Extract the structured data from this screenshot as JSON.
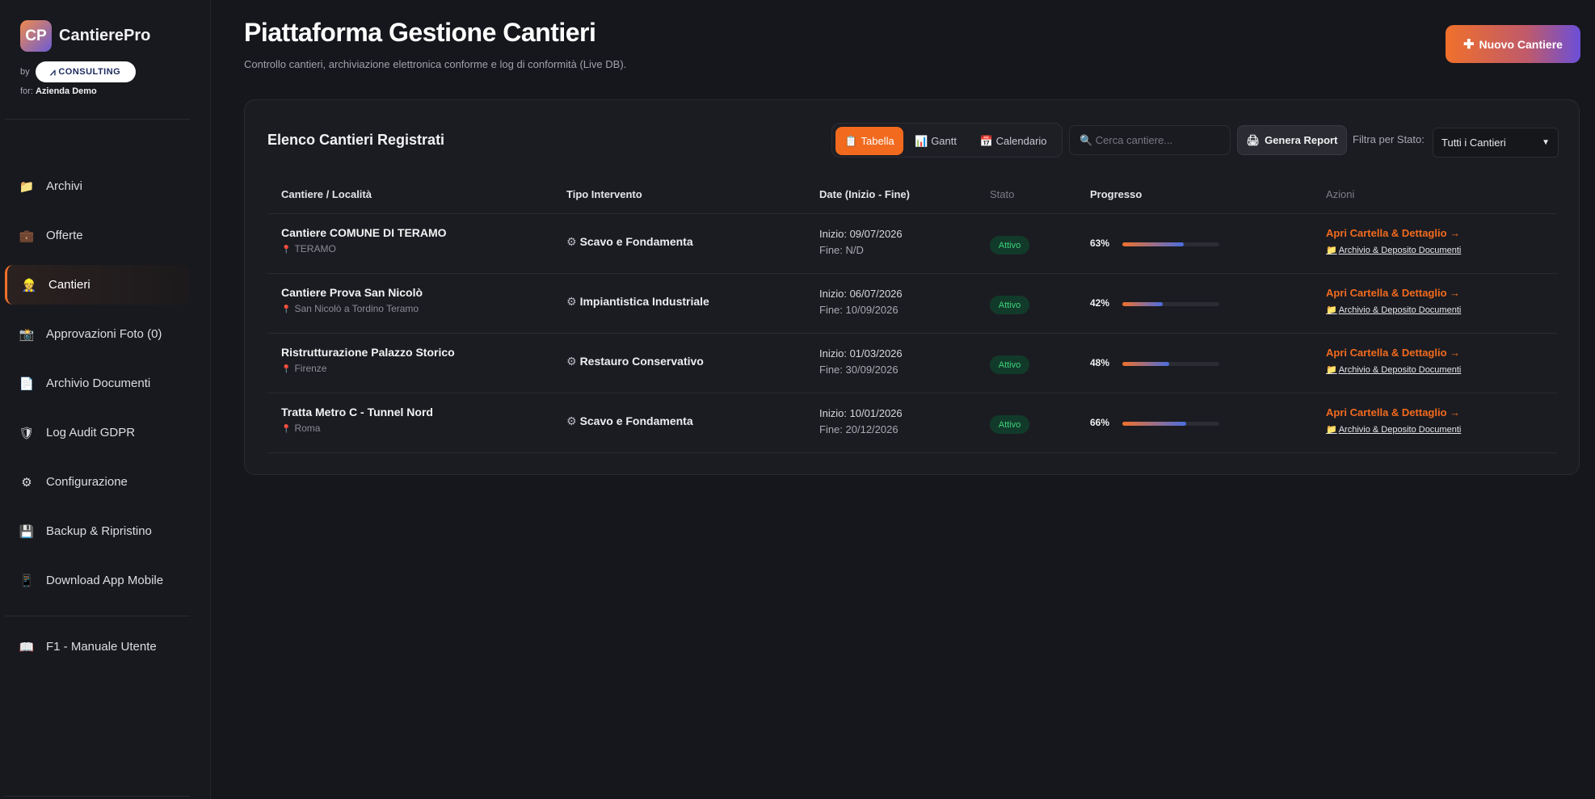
{
  "brand": {
    "logo_text": "CP",
    "name": "CantierePro",
    "by": "by",
    "partner": "CONSULTING",
    "for_label": "for:",
    "company": "Azienda Demo"
  },
  "sidebar": {
    "items": [
      {
        "label": "Archivi",
        "icon": "folder-icon"
      },
      {
        "label": "Offerte",
        "icon": "briefcase-icon"
      },
      {
        "label": "Cantieri",
        "icon": "worker-icon"
      },
      {
        "label": "Approvazioni Foto (0)",
        "icon": "camera-icon"
      },
      {
        "label": "Archivio Documenti",
        "icon": "document-icon"
      },
      {
        "label": "Log Audit GDPR",
        "icon": "shield-icon"
      },
      {
        "label": "Configurazione",
        "icon": "gear-icon"
      },
      {
        "label": "Backup & Ripristino",
        "icon": "floppy-icon"
      },
      {
        "label": "Download App Mobile",
        "icon": "phone-icon"
      }
    ],
    "active": "Cantieri",
    "manual": {
      "label": "F1 - Manuale Utente",
      "icon": "book-icon"
    }
  },
  "header": {
    "title": "Piattaforma Gestione Cantieri",
    "subtitle": "Controllo cantieri, archiviazione elettronica conforme e log di conformità (Live DB).",
    "new_button": "Nuovo Cantiere"
  },
  "card": {
    "title": "Elenco Cantieri Registrati",
    "views": [
      {
        "label": "Tabella",
        "icon": "clipboard-icon"
      },
      {
        "label": "Gantt",
        "icon": "chart-icon"
      },
      {
        "label": "Calendario",
        "icon": "calendar-icon"
      }
    ],
    "active_view": "Tabella",
    "search_placeholder": "🔍 Cerca cantiere...",
    "report_button": "Genera Report",
    "filter_label": "Filtra per Stato:",
    "filter_value": "Tutti i Cantieri"
  },
  "table": {
    "columns": [
      "Cantiere / Località",
      "Tipo Intervento",
      "Date (Inizio - Fine)",
      "Stato",
      "Progresso",
      "Azioni"
    ],
    "rows": [
      {
        "name": "Cantiere COMUNE DI TERAMO",
        "location": "TERAMO",
        "type": "Scavo e Fondamenta",
        "start": "Inizio: 09/07/2026",
        "end": "Fine: N/D",
        "status": "Attivo",
        "progress": 63,
        "progress_label": "63%",
        "action_open": "Apri Cartella & Dettaglio →",
        "action_archive": "Archivio & Deposito Documenti"
      },
      {
        "name": "Cantiere Prova San Nicolò",
        "location": "San Nicolò a Tordino Teramo",
        "type": "Impiantistica Industriale",
        "start": "Inizio: 06/07/2026",
        "end": "Fine: 10/09/2026",
        "status": "Attivo",
        "progress": 42,
        "progress_label": "42%",
        "action_open": "Apri Cartella & Dettaglio →",
        "action_archive": "Archivio & Deposito Documenti"
      },
      {
        "name": "Ristrutturazione Palazzo Storico",
        "location": "Firenze",
        "type": "Restauro Conservativo",
        "start": "Inizio: 01/03/2026",
        "end": "Fine: 30/09/2026",
        "status": "Attivo",
        "progress": 48,
        "progress_label": "48%",
        "action_open": "Apri Cartella & Dettaglio →",
        "action_archive": "Archivio & Deposito Documenti"
      },
      {
        "name": "Tratta Metro C - Tunnel Nord",
        "location": "Roma",
        "type": "Scavo e Fondamenta",
        "start": "Inizio: 10/01/2026",
        "end": "Fine: 20/12/2026",
        "status": "Attivo",
        "progress": 66,
        "progress_label": "66%",
        "action_open": "Apri Cartella & Dettaglio →",
        "action_archive": "Archivio & Deposito Documenti"
      }
    ]
  },
  "colors": {
    "accent": "#f26a1e",
    "status_active": "#3ed37a",
    "background": "#16171c"
  }
}
